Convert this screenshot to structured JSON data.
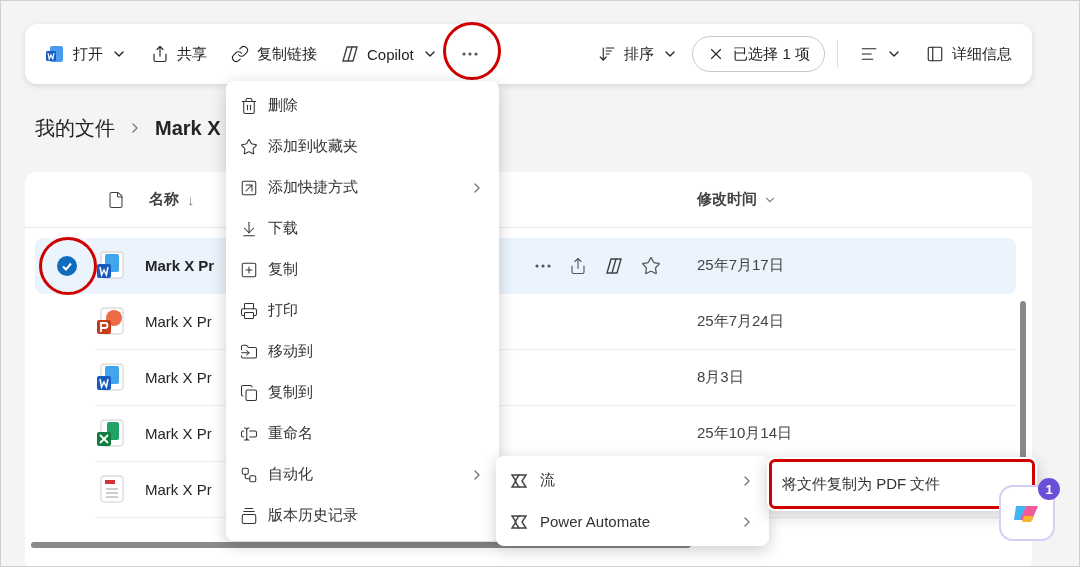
{
  "toolbar": {
    "left": [
      {
        "kind": "open",
        "label": "打开",
        "caret": true
      },
      {
        "kind": "share",
        "label": "共享",
        "caret": false
      },
      {
        "kind": "link",
        "label": "复制链接",
        "caret": false
      },
      {
        "kind": "copilot",
        "label": "Copilot",
        "caret": true
      },
      {
        "kind": "more",
        "highlighted": true
      }
    ],
    "sort": {
      "label": "排序"
    },
    "selection": {
      "label": "已选择 1 项"
    },
    "details": {
      "label": "详细信息"
    }
  },
  "breadcrumb": [
    "我的文件",
    "Mark X"
  ],
  "table": {
    "columns": [
      {
        "label": "名称",
        "sort": "↓"
      },
      {
        "label": "修改时间"
      }
    ],
    "rows": [
      {
        "kind": "word",
        "name": "Mark X Pr",
        "modified": "25年7月17日",
        "selected": true,
        "highlighted": true
      },
      {
        "kind": "powerpoint",
        "name": "Mark X Pr",
        "modified": "25年7月24日",
        "selected": false,
        "highlighted": false
      },
      {
        "kind": "word",
        "name": "Mark X Pr",
        "modified": "8月3日",
        "selected": false,
        "highlighted": false
      },
      {
        "kind": "excel",
        "name": "Mark X Pr",
        "modified": "25年10月14日",
        "selected": false,
        "highlighted": false
      },
      {
        "kind": "pdf",
        "name": "Mark X Pr",
        "selected": false,
        "highlighted": false
      }
    ]
  },
  "menu": [
    {
      "kind": "delete",
      "label": "删除",
      "submenu": false
    },
    {
      "kind": "favorite",
      "label": "添加到收藏夹",
      "submenu": false
    },
    {
      "kind": "shortcut",
      "label": "添加快捷方式",
      "submenu": true
    },
    {
      "kind": "download",
      "label": "下载",
      "submenu": false
    },
    {
      "kind": "copy",
      "label": "复制",
      "submenu": false
    },
    {
      "kind": "print",
      "label": "打印",
      "submenu": false
    },
    {
      "kind": "move",
      "label": "移动到",
      "submenu": false
    },
    {
      "kind": "copyto",
      "label": "复制到",
      "submenu": false
    },
    {
      "kind": "rename",
      "label": "重命名",
      "submenu": false
    },
    {
      "kind": "automate",
      "label": "自动化",
      "submenu": true
    },
    {
      "kind": "history",
      "label": "版本历史记录",
      "submenu": false
    }
  ],
  "submenu": [
    {
      "label": "流",
      "submenu": true
    },
    {
      "label": "Power Automate",
      "submenu": true
    }
  ],
  "flow_menu": [
    {
      "label": "将文件复制为 PDF 文件",
      "highlighted": true
    }
  ],
  "copilot_badge": "1"
}
